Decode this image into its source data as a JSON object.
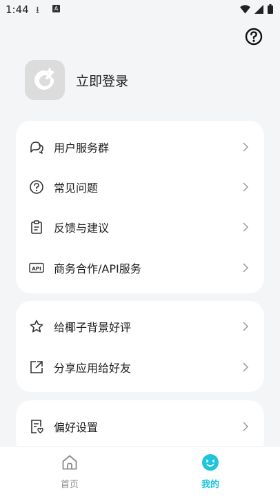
{
  "status_bar": {
    "time": "1:44"
  },
  "header": {
    "help_icon": "question-circle-icon"
  },
  "profile": {
    "login_label": "立即登录",
    "avatar_icon": "app-logo-icon"
  },
  "menu_groups": [
    {
      "items": [
        {
          "label": "用户服务群",
          "icon": "chat-bubbles-icon"
        },
        {
          "label": "常见问题",
          "icon": "question-circle-icon"
        },
        {
          "label": "反馈与建议",
          "icon": "clipboard-icon"
        },
        {
          "label": "商务合作/API服务",
          "icon": "api-icon"
        }
      ]
    },
    {
      "items": [
        {
          "label": "给椰子背景好评",
          "icon": "star-icon"
        },
        {
          "label": "分享应用给好友",
          "icon": "share-icon"
        }
      ]
    },
    {
      "items": [
        {
          "label": "偏好设置",
          "icon": "settings-doc-icon"
        }
      ]
    }
  ],
  "tabbar": {
    "tabs": [
      {
        "label": "首页",
        "icon": "home-icon",
        "active": false
      },
      {
        "label": "我的",
        "icon": "smiley-icon",
        "active": true
      }
    ]
  },
  "colors": {
    "accent": "#1fc5dc",
    "background": "#f4f5f7",
    "card": "#ffffff",
    "inactive_tab": "#8b8b8b"
  }
}
